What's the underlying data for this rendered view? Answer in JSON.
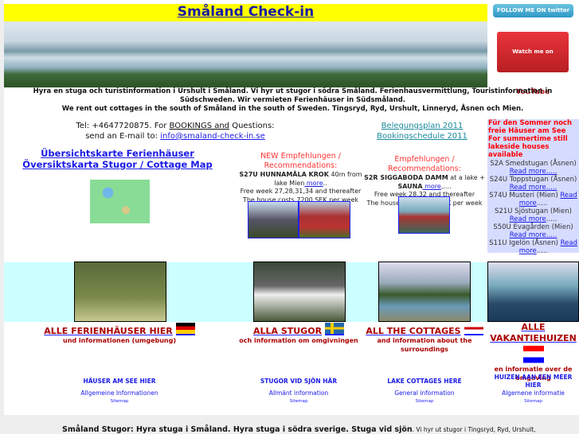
{
  "header": {
    "title": "Småland Check-in",
    "twitter": "FOLLOW ME ON twitter",
    "youtube_prefix": "Watch me on",
    "youtube_brand": "YouTube"
  },
  "intro": {
    "line1": "Hyra en stuga och turistinformation i Urshult i Småland. Vi hyr ut stugor i södra Småland.  Ferienhausvermittlung, Touristinformation in Südschweden. Wir vermieten Ferienhäuser in Südsmåland.",
    "line2": "We rent out cottages in the south of Småland in the south of Sweden. Tingsryd, Ryd, Urshult, Linneryd, Åsnen och Mien."
  },
  "contact": {
    "tel": "Tel:  +4647720875.  For ",
    "bookings": "BOOKINGS and",
    "questions": " Questions:",
    "email_label": "send an E-mail to: ",
    "email": "info@smaland-check-in.se"
  },
  "schedule": [
    "Belegungsplan 2011",
    "Bookingschedule 2011"
  ],
  "map": {
    "title": "Übersichtskarte Ferienhäuser Översiktskarta Stugor / Cottage Map"
  },
  "rec1": {
    "heading": "NEW Empfehlungen / Recommendations:",
    "name": "S27U HUNNAMÅLA KROK",
    "desc": " 40m from lake Mien",
    "more": " more",
    "tail": "..",
    "free": "Free week 27,28,31,34 and thereafter",
    "price": "The house costs 7200 SEK per week"
  },
  "rec2": {
    "heading": "Empfehlungen / Recommendations:",
    "name": "S2R SIGGABODA DAMM",
    "desc": " at a lake + ",
    "name2": "SAUNA",
    "more": " more",
    "tail": ",....",
    "free": "Free week 28,32 and thereafter",
    "price": "The house costs 6400 SEK per week"
  },
  "sidebar": {
    "heading": [
      "Für den Sommer noch",
      "freie Häuser am See",
      "For summertime still",
      "lakeside houses available"
    ],
    "items": [
      {
        "name": "S2A Smedstugan (Åsnen)",
        "more": "Read more....."
      },
      {
        "name": "S24U Toppstugan (Åsnen)",
        "more": "Read more....."
      },
      {
        "name": "S74U Musteri (Mien) ",
        "more": "Read more",
        "tail": "....."
      },
      {
        "name": "S21U Sjöstugan (Mien) ",
        "more": "Read more",
        "tail": "....."
      },
      {
        "name": "S50U Evagården (Mien)",
        "more": "Read more....."
      },
      {
        "name": "S11U Igelön (Åsnen) ",
        "more": "Read more",
        "tail": "....."
      }
    ]
  },
  "languages": [
    {
      "title": "ALLE FERIENHÄUSER HIER",
      "sub": "und informationen (umgebung)",
      "lake": "HÄUSER AM SEE HIER",
      "general": "Allgemeine Informationen",
      "sitemap": "Sitemap",
      "flag": "germany-flag"
    },
    {
      "title": "ALLA STUGOR",
      "sub": "och information om omgivningen",
      "lake": "STUGOR VID SJÖN HÄR",
      "general": "Allmänt information",
      "sitemap": "Sitemap",
      "flag": "sweden-flag"
    },
    {
      "title": "ALL THE COTTAGES",
      "sub": "and information about the surroundings",
      "lake": "LAKE COTTAGES HERE",
      "general": "General information",
      "sitemap": "Sitemap",
      "flag": "uk-flag"
    },
    {
      "title": "ALLE VAKANTIEHUIZEN",
      "sub": "en informatie over de omgeving",
      "lake": "HUIZEN AAN EEN MEER HIER",
      "general": "Algemene informatie",
      "sitemap": "Sitemap",
      "flag": "netherlands-flag"
    }
  ],
  "footer": {
    "bold": "Småland Stugor: Hyra stuga i Småland. Hyra stuga i södra sverige. Stuga vid sjön",
    "rest": ". Vi hyr ut stugor i Tingsryd, Ryd, Urshult,"
  }
}
